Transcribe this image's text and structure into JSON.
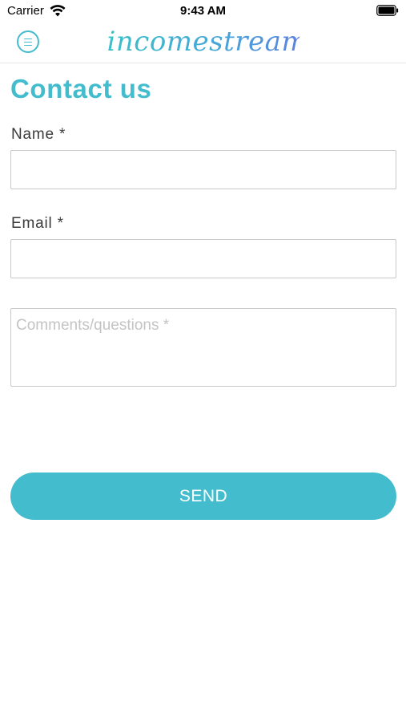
{
  "status_bar": {
    "carrier": "Carrier",
    "time": "9:43 AM"
  },
  "nav": {
    "logo": "incomestreams",
    "menu_icon": "hamburger-menu-icon"
  },
  "page": {
    "title": "Contact us"
  },
  "form": {
    "name_label": "Name *",
    "name_value": "",
    "email_label": "Email *",
    "email_value": "",
    "comments_placeholder": "Comments/questions *",
    "send_label": "SEND"
  },
  "colors": {
    "accent": "#43bccd",
    "border": "#c8c8c8",
    "label_text": "#3a3a3a"
  }
}
